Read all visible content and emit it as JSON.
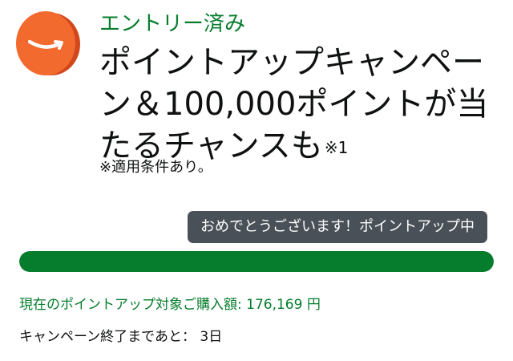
{
  "logo": {
    "icon": "amazon-smile-coin-icon",
    "color": "#f26a2e"
  },
  "status_text": "エントリー済み",
  "headline": {
    "lines": [
      "ポイントアップキャンペー",
      "ン＆100,000ポイントが当",
      "たるチャンスも"
    ],
    "note_mark": "※1"
  },
  "conditions_note": "※適用条件あり。",
  "status_badge": "おめでとうございます！ポイントアップ中",
  "progress": {
    "fraction": 1.0,
    "color": "#067d2c"
  },
  "purchase": {
    "label": "現在のポイントアップ対象ご購入額:",
    "amount": "176,169 円"
  },
  "remaining": {
    "label": "キャンペーン終了まであと：",
    "days": "3日"
  }
}
